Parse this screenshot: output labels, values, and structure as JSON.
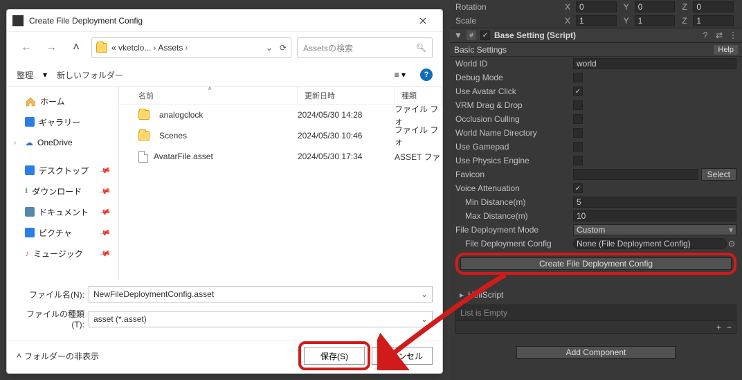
{
  "dialog": {
    "title": "Create File Deployment Config",
    "breadcrumb": {
      "parent": "« vketclo...",
      "current": "Assets"
    },
    "search_placeholder": "Assetsの検索",
    "toolbar": {
      "organize": "整理",
      "new_folder": "新しいフォルダー"
    },
    "sidebar": {
      "home": "ホーム",
      "gallery": "ギャラリー",
      "onedrive": "OneDrive",
      "desktop": "デスクトップ",
      "downloads": "ダウンロード",
      "documents": "ドキュメント",
      "pictures": "ピクチャ",
      "music": "ミュージック"
    },
    "columns": {
      "name": "名前",
      "date": "更新日時",
      "type": "種類"
    },
    "rows": [
      {
        "icon": "folder",
        "name": "analogclock",
        "date": "2024/05/30 14:28",
        "type": "ファイル フォ"
      },
      {
        "icon": "folder",
        "name": "Scenes",
        "date": "2024/05/30 10:46",
        "type": "ファイル フォ"
      },
      {
        "icon": "file",
        "name": "AvatarFile.asset",
        "date": "2024/05/30 17:34",
        "type": "ASSET ファ"
      }
    ],
    "fields": {
      "filename_label": "ファイル名(N):",
      "filename_value": "NewFileDeploymentConfig.asset",
      "filetype_label": "ファイルの種類(T):",
      "filetype_value": "asset (*.asset)"
    },
    "footer": {
      "hide_folders": "フォルダーの非表示",
      "save": "保存(S)",
      "cancel": "キャンセル"
    }
  },
  "inspector": {
    "transform": {
      "rotation_label": "Rotation",
      "rotation": {
        "x": "0",
        "y": "0",
        "z": "0"
      },
      "scale_label": "Scale",
      "scale": {
        "x": "1",
        "y": "1",
        "z": "1"
      }
    },
    "component_title": "Base Setting (Script)",
    "section_label": "Basic Settings",
    "help_label": "Help",
    "props": {
      "world_id": {
        "label": "World ID",
        "value": "world"
      },
      "debug_mode": {
        "label": "Debug Mode",
        "checked": false
      },
      "use_avatar_click": {
        "label": "Use Avatar Click",
        "checked": true
      },
      "vrm_drag": {
        "label": "VRM Drag & Drop",
        "checked": false
      },
      "occlusion": {
        "label": "Occlusion Culling",
        "checked": false
      },
      "world_name_dir": {
        "label": "World Name Directory",
        "checked": false
      },
      "use_gamepad": {
        "label": "Use Gamepad",
        "checked": false
      },
      "use_physics": {
        "label": "Use Physics Engine",
        "checked": false
      },
      "favicon": {
        "label": "Favicon",
        "button": "Select"
      },
      "voice_atten": {
        "label": "Voice Attenuation",
        "checked": true
      },
      "min_dist": {
        "label": "Min Distance(m)",
        "value": "5"
      },
      "max_dist": {
        "label": "Max Distance(m)",
        "value": "10"
      },
      "deploy_mode": {
        "label": "File Deployment Mode",
        "value": "Custom"
      },
      "deploy_config": {
        "label": "File Deployment Config",
        "value": "None (File Deployment Config)"
      },
      "create_btn": "Create File Deployment Config"
    },
    "heliscripts": {
      "header": "HeliScript",
      "empty": "List is Empty"
    },
    "add_component": "Add Component"
  }
}
